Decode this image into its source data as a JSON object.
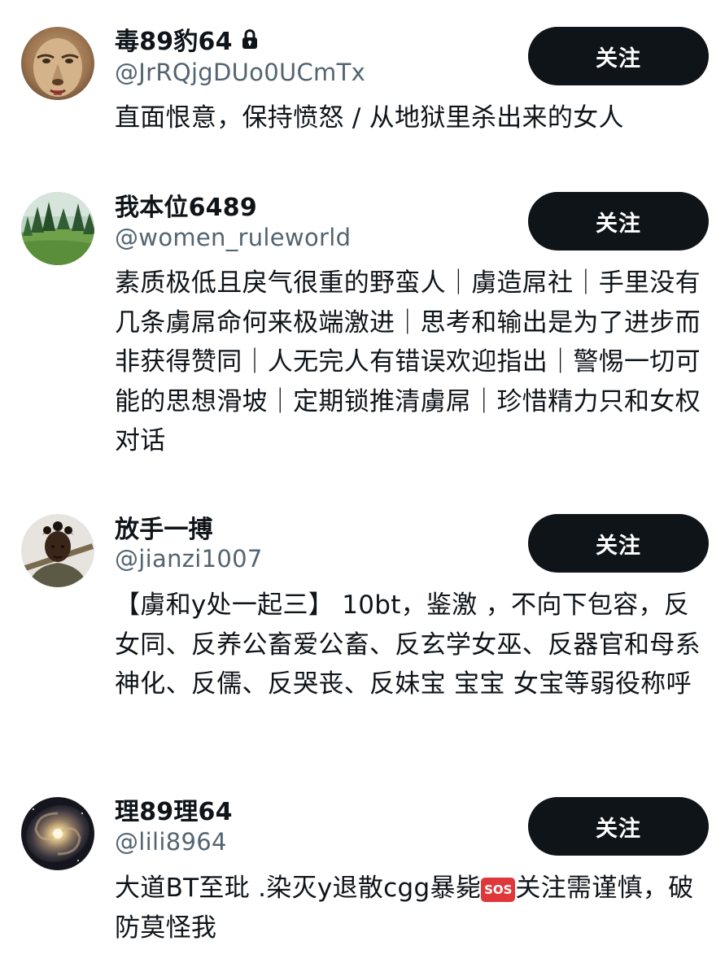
{
  "users": [
    {
      "name": "毒89豹64",
      "handle": "@JrRQjgDUo0UCmTx",
      "bio": "直面恨意，保持愤怒 / 从地狱里杀出来的女人",
      "follow_label": "关注",
      "locked": true,
      "avatar_icon": "lioness-face"
    },
    {
      "name": "我本位6489",
      "handle": "@women_ruleworld",
      "bio": "素质极低且戾气很重的野蛮人｜虜造屌社｜手里没有几条虜屌命何来极端激进｜思考和输出是为了进步而非获得赞同｜人无完人有错误欢迎指出｜警惕一切可能的思想滑坡｜定期锁推清虜屌｜珍惜精力只和女权对话",
      "follow_label": "关注",
      "locked": false,
      "avatar_icon": "forest-meadow"
    },
    {
      "name": "放手一搏",
      "handle": "@jianzi1007",
      "bio": "【虜和y处一起三】 10bt，鉴激 ，不向下包容，反女同、反养公畜爱公畜、反玄学女巫、反器官和母系神化、反儒、反哭丧、反妹宝 宝宝 女宝等弱役称呼",
      "follow_label": "关注",
      "locked": false,
      "avatar_icon": "warrior-portrait"
    },
    {
      "name": "理89理64",
      "handle": "@lili8964",
      "bio_before": "大道BT至玭 .染灭y退散cgg暴毙",
      "sos_label": "SOS",
      "bio_after": "关注需谨慎，破防莫怪我",
      "follow_label": "关注",
      "locked": false,
      "avatar_icon": "spiral-galaxy"
    }
  ]
}
